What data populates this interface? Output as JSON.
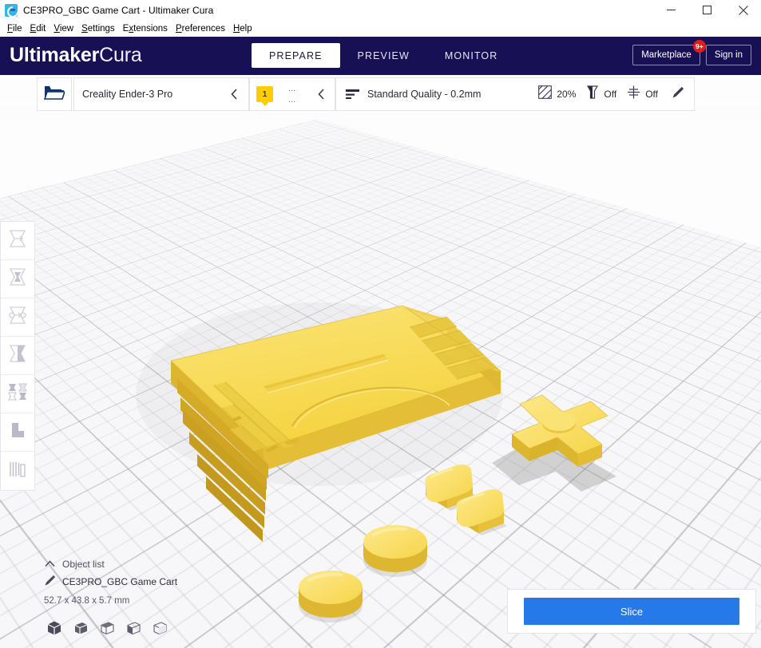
{
  "window": {
    "title": "CE3PRO_GBC Game Cart - Ultimaker Cura",
    "app_icon": "cura-logo-icon",
    "controls": {
      "minimize": "minimize-icon",
      "maximize": "maximize-icon",
      "close": "close-icon"
    }
  },
  "menubar": {
    "items": [
      {
        "label": "File",
        "mnemonic": "F"
      },
      {
        "label": "Edit",
        "mnemonic": "E"
      },
      {
        "label": "View",
        "mnemonic": "V"
      },
      {
        "label": "Settings",
        "mnemonic": "S"
      },
      {
        "label": "Extensions",
        "mnemonic": "x"
      },
      {
        "label": "Preferences",
        "mnemonic": "P"
      },
      {
        "label": "Help",
        "mnemonic": "H"
      }
    ]
  },
  "header": {
    "logo_bold": "Ultimaker",
    "logo_light": "Cura",
    "background_color": "#181054",
    "tabs": [
      {
        "label": "PREPARE",
        "active": true
      },
      {
        "label": "PREVIEW",
        "active": false
      },
      {
        "label": "MONITOR",
        "active": false
      }
    ],
    "marketplace": {
      "label": "Marketplace",
      "badge": "9+",
      "badge_color": "#e11a1a"
    },
    "signin": {
      "label": "Sign in"
    }
  },
  "settings_bar": {
    "open_file_icon": "open-folder-icon",
    "printer": {
      "name": "Creality Ender-3 Pro",
      "collapse_icon": "chevron-left-icon"
    },
    "extruder": {
      "number": "1",
      "material": "...",
      "nozzle": "...",
      "collapse_icon": "chevron-left-icon",
      "badge_color": "#ffcd00"
    },
    "profile": {
      "icon": "print-quality-icon",
      "name": "Standard Quality - 0.2mm",
      "metrics": [
        {
          "icon": "infill-icon",
          "value": "20%"
        },
        {
          "icon": "support-icon",
          "value": "Off"
        },
        {
          "icon": "adhesion-icon",
          "value": "Off"
        }
      ],
      "edit_icon": "pencil-icon"
    }
  },
  "tools": [
    {
      "name": "move-tool",
      "icon": "move-icon"
    },
    {
      "name": "scale-tool",
      "icon": "scale-icon"
    },
    {
      "name": "rotate-tool",
      "icon": "rotate-icon"
    },
    {
      "name": "mirror-tool",
      "icon": "mirror-icon"
    },
    {
      "name": "per-model-settings-tool",
      "icon": "per-model-settings-icon"
    },
    {
      "name": "support-blocker-tool",
      "icon": "support-blocker-icon"
    },
    {
      "name": "smart-slice-tool",
      "icon": "smart-slice-icon"
    }
  ],
  "object_list": {
    "caret_icon": "chevron-up-icon",
    "title": "Object list",
    "item": {
      "icon": "pencil-icon",
      "name": "CE3PRO_GBC Game Cart"
    },
    "dimensions": "52.7 x 43.8 x 5.7 mm"
  },
  "view_modes": [
    {
      "name": "view-3d",
      "icon": "cube-3d-icon",
      "active": true
    },
    {
      "name": "view-front",
      "icon": "cube-front-icon",
      "active": false
    },
    {
      "name": "view-top",
      "icon": "cube-top-icon",
      "active": false
    },
    {
      "name": "view-left",
      "icon": "cube-left-icon",
      "active": false
    },
    {
      "name": "view-right",
      "icon": "cube-right-icon",
      "active": false
    }
  ],
  "action_panel": {
    "slice_label": "Slice",
    "slice_color": "#2579e8"
  },
  "viewport": {
    "model_color": "#f7d84a",
    "plate_color": "#f7f7f9",
    "model_parts": [
      "cartridge-body",
      "dpad",
      "button-a",
      "button-b",
      "start-pill",
      "select-pill"
    ]
  }
}
